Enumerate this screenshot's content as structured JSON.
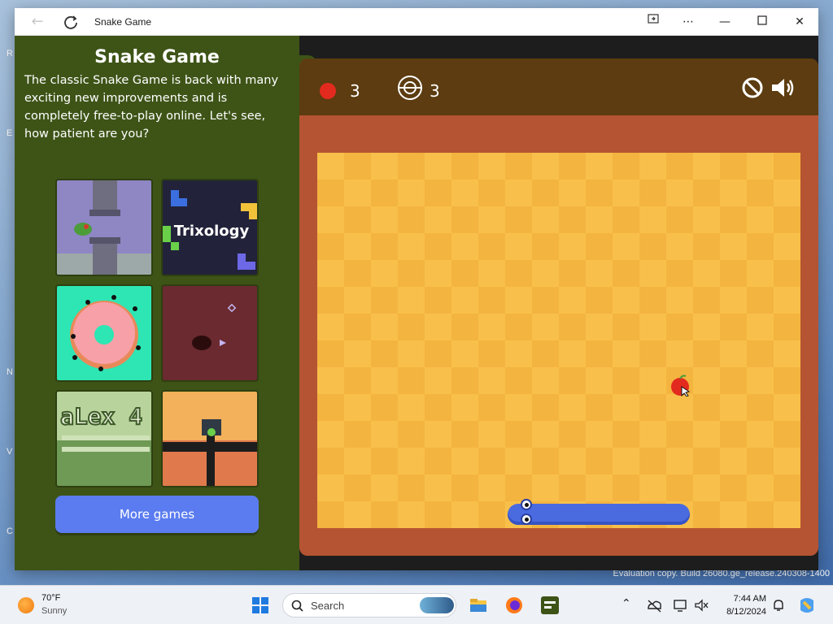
{
  "window": {
    "title": "Snake Game"
  },
  "panel": {
    "title": "Snake Game",
    "description": "The classic Snake Game is back with many exciting new improvements and is completely free-to-play online. Let's see, how patient are you?",
    "more_games_label": "More games",
    "thumbnails": [
      {
        "name": "flappy-game",
        "icon": "tower-bird"
      },
      {
        "name": "trixology-game",
        "label": "Trixology",
        "icon": "tetromino"
      },
      {
        "name": "donut-dots-game",
        "icon": "donut"
      },
      {
        "name": "space-game",
        "icon": "ship"
      },
      {
        "name": "alex-4-game",
        "icon": "retro-title"
      },
      {
        "name": "pacman-game",
        "icon": "maze"
      }
    ]
  },
  "game": {
    "score": "3",
    "target": "3",
    "colors": {
      "frame": "#b55432",
      "hud": "#5c3c10",
      "board_light": "#f8c04a",
      "board_dark": "#f4b440",
      "snake": "#4a6ae0",
      "apple": "#e32a1e"
    }
  },
  "desktop": {
    "evaluation_text": "Evaluation copy. Build 26080.ge_release.240308-1400"
  },
  "taskbar": {
    "weather_temp": "70°F",
    "weather_condition": "Sunny",
    "search_label": "Search",
    "time": "7:44 AM",
    "date": "8/12/2024"
  }
}
